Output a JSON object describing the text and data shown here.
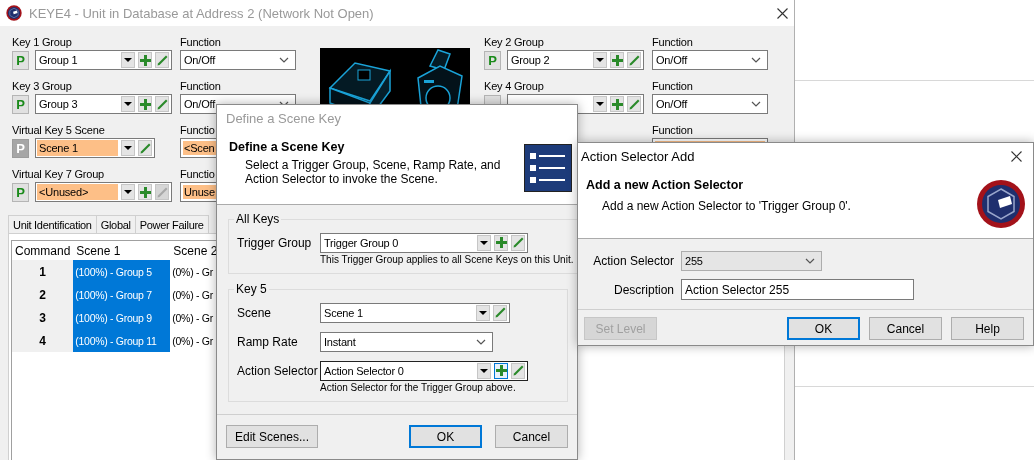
{
  "main_window": {
    "title": "KEYE4 - Unit in Database at Address 2 (Network Not Open)",
    "left_keys": [
      {
        "kind": "group",
        "label": "Key 1 Group",
        "p_label": "P",
        "p_enabled": true,
        "value": "Group 1",
        "highlighted": false,
        "edit_enabled": true,
        "function_label": "Function",
        "function_value": "On/Off",
        "function_highlighted": false
      },
      {
        "kind": "group",
        "label": "Key 3 Group",
        "p_label": "P",
        "p_enabled": true,
        "value": "Group 3",
        "highlighted": false,
        "edit_enabled": true,
        "function_label": "Function",
        "function_value": "On/Off",
        "function_highlighted": false
      },
      {
        "kind": "scene",
        "label": "Virtual Key 5 Scene",
        "p_label": "P",
        "p_enabled": false,
        "value": "Scene 1",
        "highlighted": true,
        "edit_enabled": true,
        "function_label": "Functio",
        "function_value": "<Scen",
        "function_highlighted": true
      },
      {
        "kind": "group",
        "label": "Virtual Key 7 Group",
        "p_label": "P",
        "p_enabled": true,
        "value": "<Unused>",
        "highlighted": true,
        "edit_enabled": false,
        "function_label": "Functio",
        "function_value": "Unuse",
        "function_highlighted": true
      }
    ],
    "right_keys": [
      {
        "kind": "group",
        "label": "Key 2 Group",
        "p_label": "P",
        "p_enabled": true,
        "value": "Group 2",
        "highlighted": false,
        "edit_enabled": true,
        "function_label": "Function",
        "function_value": "On/Off",
        "function_highlighted": false
      },
      {
        "kind": "group",
        "label": "Key 4 Group",
        "p_enabled": true,
        "highlighted": false,
        "edit_enabled": true,
        "function_label": "Function",
        "function_value": "On/Off",
        "function_highlighted": false
      },
      {
        "kind": "function_only",
        "function_label": "Function",
        "function_highlighted": true
      }
    ],
    "tabs": [
      {
        "label": "Unit Identification"
      },
      {
        "label": "Global"
      },
      {
        "label": "Power Failure"
      }
    ],
    "table": {
      "columns": [
        {
          "label": "Command",
          "selected": false
        },
        {
          "label": "Scene 1",
          "selected": true
        },
        {
          "label": "Scene 2",
          "selected": false
        }
      ],
      "rows": [
        {
          "cells": [
            "1",
            "(100%) - Group 5",
            "(0%) - Gr"
          ]
        },
        {
          "cells": [
            "2",
            "(100%) - Group 7",
            "(0%) - Gr"
          ]
        },
        {
          "cells": [
            "3",
            "(100%) - Group 9",
            "(0%) - Gr"
          ]
        },
        {
          "cells": [
            "4",
            "(100%) - Group 11",
            "(0%) - Gr"
          ]
        }
      ]
    }
  },
  "scene_key_dialog": {
    "title": "Define a Scene Key",
    "active": false,
    "heading": "Define a Scene Key",
    "description": "Select a Trigger Group, Scene, Ramp Rate, and Action Selector to invoke the Scene.",
    "groups": [
      {
        "legend": "All Keys",
        "fields": [
          {
            "kind": "combo",
            "label": "Trigger Group",
            "value": "Trigger Group 0",
            "add": true,
            "edit": true,
            "focused": false,
            "note": "This Trigger Group applies to all Scene Keys on this Unit."
          }
        ]
      },
      {
        "legend": "Key 5",
        "fields": [
          {
            "kind": "combo",
            "label": "Scene",
            "value": "Scene 1",
            "add": false,
            "edit": true,
            "focused": false
          },
          {
            "kind": "select",
            "label": "Ramp Rate",
            "value": "Instant"
          },
          {
            "kind": "combo",
            "label": "Action Selector",
            "value": "Action Selector 0",
            "add": true,
            "edit": true,
            "focused": true,
            "note": "Action Selector for the Trigger Group above."
          }
        ]
      }
    ],
    "left_buttons": [
      {
        "label": "Edit Scenes...",
        "default": false,
        "disabled": false
      }
    ],
    "buttons": [
      {
        "label": "OK",
        "default": true,
        "disabled": false
      },
      {
        "label": "Cancel",
        "default": false,
        "disabled": false
      }
    ]
  },
  "action_selector_dialog": {
    "title": "Action Selector Add",
    "active": true,
    "heading": "Add a new Action Selector",
    "description": "Add a new Action Selector to 'Trigger Group 0'.",
    "fields": [
      {
        "kind": "list",
        "label": "Action Selector",
        "value": "255"
      },
      {
        "kind": "text",
        "label": "Description",
        "value": "Action Selector 255"
      }
    ],
    "left_buttons": [
      {
        "label": "Set Level",
        "default": false,
        "disabled": true
      }
    ],
    "buttons": [
      {
        "label": "OK",
        "default": true,
        "disabled": false
      },
      {
        "label": "Cancel",
        "default": false,
        "disabled": false
      },
      {
        "label": "Help",
        "default": false,
        "disabled": false
      }
    ]
  }
}
